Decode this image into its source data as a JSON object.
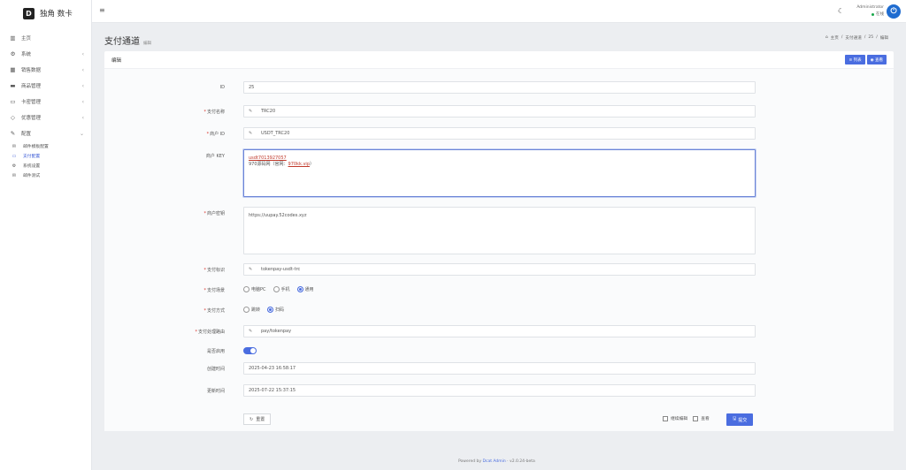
{
  "brand": {
    "logo": "D",
    "name": "独角 数卡"
  },
  "sidebar": {
    "items": [
      {
        "icon": "bar-chart-icon",
        "glyph": "▥",
        "label": "主页",
        "chev": ""
      },
      {
        "icon": "gear-icon",
        "glyph": "⚙",
        "label": "系统",
        "chev": "‹"
      },
      {
        "icon": "grid-icon",
        "glyph": "▦",
        "label": "销售数据",
        "chev": "‹"
      },
      {
        "icon": "store-icon",
        "glyph": "▬",
        "label": "商品管理",
        "chev": "‹"
      },
      {
        "icon": "card-icon",
        "glyph": "▭",
        "label": "卡密管理",
        "chev": "‹"
      },
      {
        "icon": "diamond-icon",
        "glyph": "◇",
        "label": "优惠管理",
        "chev": "‹"
      },
      {
        "icon": "wrench-icon",
        "glyph": "✎",
        "label": "配置",
        "chev": "⌄"
      }
    ],
    "sub_items": [
      {
        "icon": "envelope-icon",
        "glyph": "✉",
        "label": "邮件模板配置",
        "active": false
      },
      {
        "icon": "payment-icon",
        "glyph": "▭",
        "label": "支付配置",
        "active": true
      },
      {
        "icon": "cogs-icon",
        "glyph": "⚙",
        "label": "系统设置",
        "active": false
      },
      {
        "icon": "envelope-icon",
        "glyph": "✉",
        "label": "邮件测试",
        "active": false
      }
    ]
  },
  "topbar": {
    "menu_glyph": "≡",
    "theme_glyph": "☾",
    "user_name": "Administrator",
    "user_status": "在线",
    "avatar_glyph": "⏻"
  },
  "page": {
    "title": "支付通道",
    "subtitle": "编辑",
    "breadcrumb": [
      "主页",
      "/",
      "支付通道",
      "/",
      "25",
      "/",
      "编辑"
    ],
    "home_glyph": "⌂"
  },
  "card": {
    "title": "编辑",
    "list_button": "≡ 列表",
    "view_button": "◉ 查看"
  },
  "form": {
    "id_label": "ID",
    "id_value": "25",
    "pay_name_label": "支付名称",
    "pay_name_value": "TRC20",
    "merchant_id_label": "商户 ID",
    "merchant_id_value": "USDT_TRC20",
    "merchant_key_label": "商户 KEY",
    "merchant_key_line1": "usdt7013927057",
    "merchant_key_line2_prefix": "970源码网（官网：",
    "merchant_key_line2_link": "970kk.vip",
    "merchant_key_line2_suffix": "）",
    "merchant_secret_label": "商户密钥",
    "merchant_secret_value": "https://uupay.52codes.xyz",
    "pay_check_label": "支付标识",
    "pay_check_value": "tokenpay-usdt-trc",
    "pay_scene_label": "支付场景",
    "pay_scene_options": [
      "电脑PC",
      "手机",
      "通用"
    ],
    "pay_scene_selected": "通用",
    "pay_method_label": "支付方式",
    "pay_method_options": [
      "跳转",
      "扫码"
    ],
    "pay_method_selected": "扫码",
    "pay_handle_label": "支付处理路由",
    "pay_handle_value": "pay/tokenpay",
    "is_open_label": "是否启用",
    "is_open": true,
    "created_label": "创建时间",
    "created_value": "2025-04-23 16:58:17",
    "updated_label": "更新时间",
    "updated_value": "2025-07-22 15:37:15",
    "required_mark": "*",
    "pencil_glyph": "✎",
    "reset_button": "重置",
    "reset_glyph": "↻",
    "continue_edit": "继续编辑",
    "view_option": "查看",
    "submit_button": "提交",
    "submit_glyph": "🖫"
  },
  "footer": {
    "powered_prefix": "Powered by ",
    "powered_link": "Dcat Admin",
    "version": " · v2.0.24-beta"
  },
  "colors": {
    "accent": "#4a6de0",
    "sidebar_bg": "#ffffff",
    "page_bg": "#eceef1",
    "online": "#19a84b"
  }
}
